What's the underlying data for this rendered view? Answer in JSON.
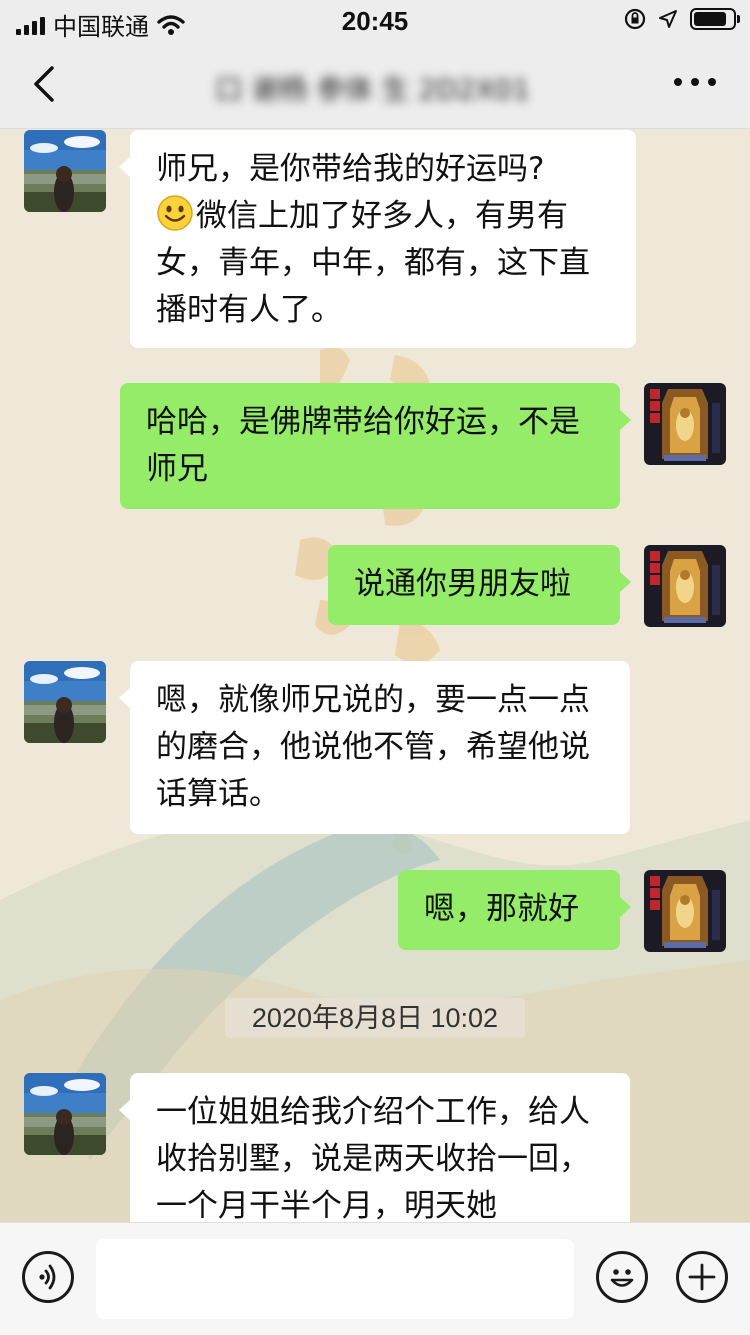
{
  "status_bar": {
    "carrier": "中国联通",
    "time": "20:45",
    "battery_level": 0.85
  },
  "nav": {
    "title": "口 谢杨 参体 生 2D2X01"
  },
  "messages": [
    {
      "side": "left",
      "text": "师兄，是你带给我的好运吗?"
    },
    {
      "side": "left",
      "text": "微信上加了好多人，有男有女，青年，中年，都有，这下直播时有人了。"
    },
    {
      "side": "right",
      "text": "哈哈，是佛牌带给你好运，不是师兄"
    },
    {
      "side": "right",
      "text": "说通你男朋友啦"
    },
    {
      "side": "left",
      "text": "嗯，就像师兄说的，要一点一点的磨合，他说他不管，希望他说话算话。"
    },
    {
      "side": "right",
      "text": "嗯，那就好"
    },
    {
      "side": "timestamp",
      "text": "2020年8月8日 10:02"
    },
    {
      "side": "left",
      "text": "一位姐姐给我介绍个工作，给人收拾别墅，说是两天收拾一回，一个月干半个月，明天她"
    }
  ],
  "icons": {
    "back": "chevron-left-icon",
    "more": "more-dots-icon",
    "voice": "voice-icon",
    "emoji": "emoji-icon",
    "plus": "plus-icon"
  },
  "colors": {
    "own_bubble": "#95ec69",
    "other_bubble": "#ffffff",
    "bar_bg": "#ededed"
  }
}
